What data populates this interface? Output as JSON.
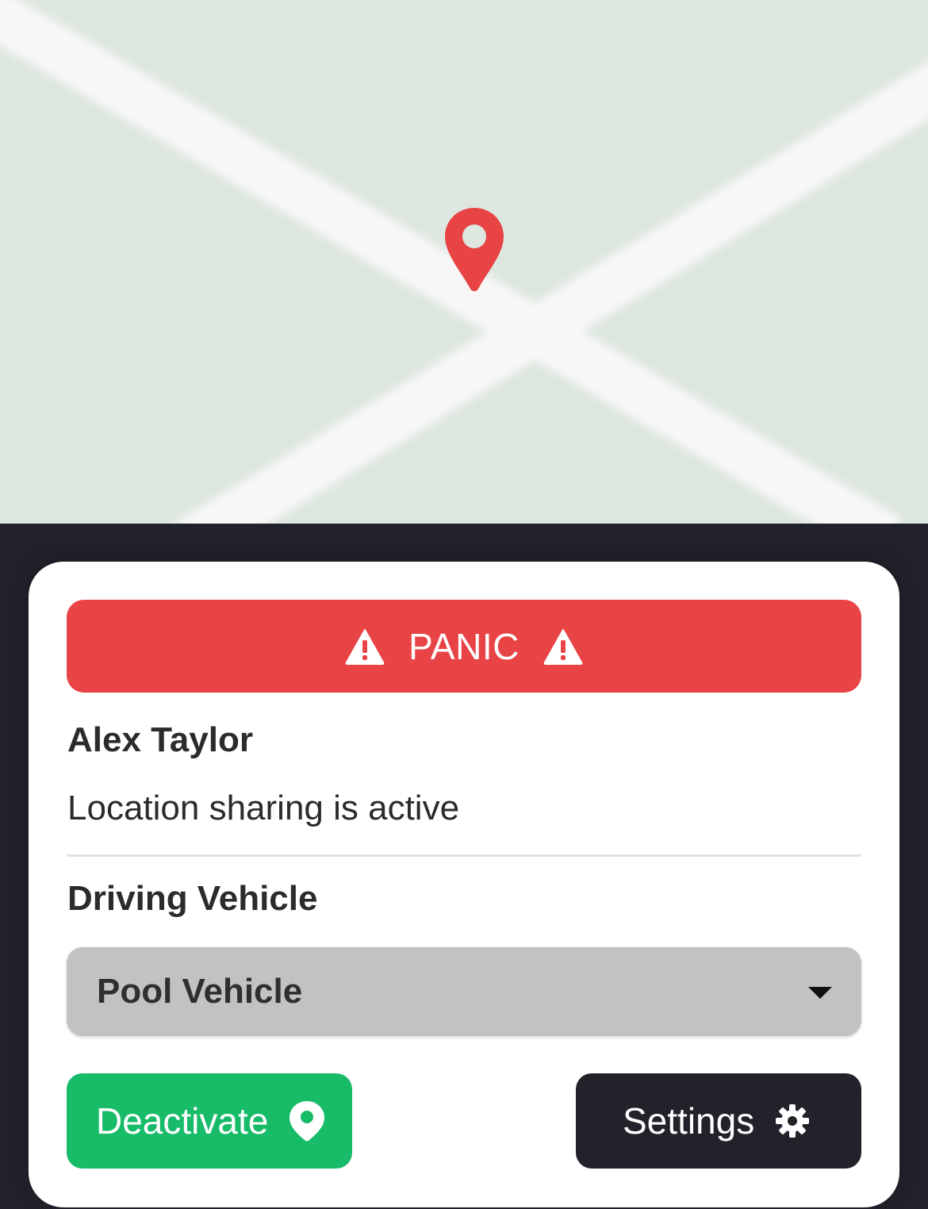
{
  "map": {
    "background_color": "#dde7df",
    "road_color": "#f7f7f7",
    "pin_icon": "map-pin-icon",
    "pin_color": "#e84345"
  },
  "panic": {
    "label": "PANIC",
    "color": "#e84345",
    "icon": "warning-triangle-icon"
  },
  "user": {
    "name": "Alex Taylor",
    "status": "Location sharing is active"
  },
  "vehicle": {
    "section_title": "Driving Vehicle",
    "selected": "Pool Vehicle"
  },
  "actions": {
    "deactivate_label": "Deactivate",
    "deactivate_icon": "location-pin-icon",
    "deactivate_color": "#17bb68",
    "settings_label": "Settings",
    "settings_icon": "gear-icon",
    "settings_color": "#22222b"
  }
}
